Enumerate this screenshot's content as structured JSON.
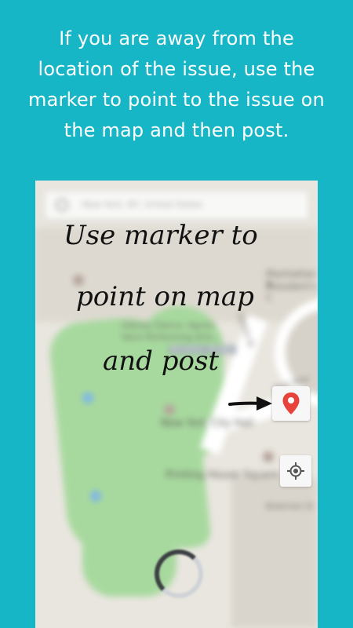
{
  "header": {
    "line1": "If you are away from the",
    "line2": "location of the issue, use the",
    "line3": "marker to point to the issue on",
    "line4": "the map and then post."
  },
  "map": {
    "search_placeholder": "New York, NY, United States",
    "labels": {
      "manhattan": "Manhattan B",
      "presidents": "President's C",
      "dance": "Gibney Dance: Agnes",
      "performing": "Varis Performing Arts...",
      "brooklyn_bridge": "Brooklyn Bridge",
      "centre_st": "Centre St",
      "park_row": "Park Row",
      "city_hall": "New York City Hall",
      "printing_house": "Printing House Square",
      "beekman": "Beekman St"
    }
  },
  "overlay": {
    "line1": "Use marker to",
    "line2": "point on map",
    "line3": "and post"
  },
  "icons": {
    "marker": "map-marker-icon",
    "locate": "my-location-icon",
    "arrow": "arrow-right-icon",
    "spinner": "loading-spinner-icon"
  },
  "colors": {
    "background": "#17b6c6",
    "marker": "#e8423c",
    "park": "#a7d99e"
  }
}
